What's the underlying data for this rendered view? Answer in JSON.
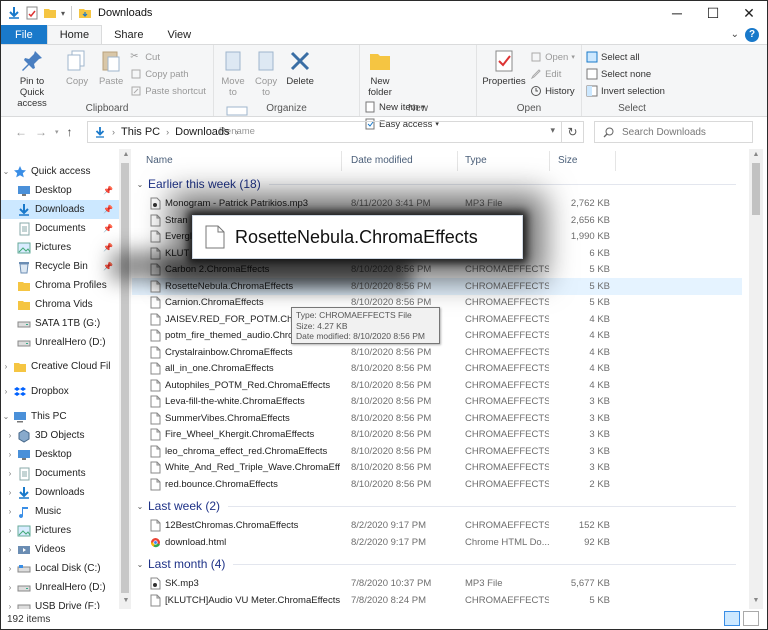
{
  "window": {
    "title": "Downloads",
    "controls": [
      "─",
      "☐",
      "✕"
    ]
  },
  "tabs": [
    {
      "label": "File"
    },
    {
      "label": "Home"
    },
    {
      "label": "Share"
    },
    {
      "label": "View"
    }
  ],
  "ribbon": {
    "clipboard": {
      "label": "Clipboard",
      "pin": "Pin to Quick access",
      "copy": "Copy",
      "paste": "Paste",
      "cut": "Cut",
      "copy_path": "Copy path",
      "paste_shortcut": "Paste shortcut"
    },
    "organize": {
      "label": "Organize",
      "move_to": "Move to",
      "copy_to": "Copy to",
      "delete": "Delete",
      "rename": "Rename"
    },
    "new": {
      "label": "New",
      "new_folder": "New folder",
      "new_item": "New item",
      "easy_access": "Easy access"
    },
    "open": {
      "label": "Open",
      "properties": "Properties",
      "open": "Open",
      "edit": "Edit",
      "history": "History"
    },
    "select": {
      "label": "Select",
      "select_all": "Select all",
      "select_none": "Select none",
      "invert": "Invert selection"
    }
  },
  "address": {
    "path": [
      "This PC",
      "Downloads"
    ],
    "search_placeholder": "Search Downloads"
  },
  "nav": {
    "items": [
      {
        "label": "Quick access"
      },
      {
        "label": "Desktop"
      },
      {
        "label": "Downloads"
      },
      {
        "label": "Documents"
      },
      {
        "label": "Pictures"
      },
      {
        "label": "Recycle Bin"
      },
      {
        "label": "Chroma Profiles"
      },
      {
        "label": "Chroma Vids"
      },
      {
        "label": "SATA 1TB (G:)"
      },
      {
        "label": "UnrealHero (D:)"
      },
      {
        "label": "Creative Cloud Fil"
      },
      {
        "label": "Dropbox"
      },
      {
        "label": "This PC"
      },
      {
        "label": "3D Objects"
      },
      {
        "label": "Desktop"
      },
      {
        "label": "Documents"
      },
      {
        "label": "Downloads"
      },
      {
        "label": "Music"
      },
      {
        "label": "Pictures"
      },
      {
        "label": "Videos"
      },
      {
        "label": "Local Disk (C:)"
      },
      {
        "label": "UnrealHero (D:)"
      },
      {
        "label": "USB Drive (F:)"
      }
    ]
  },
  "columns": {
    "name": "Name",
    "date": "Date modified",
    "type": "Type",
    "size": "Size"
  },
  "groups": [
    {
      "label": "Earlier this week (18)"
    },
    {
      "label": "Last week (2)"
    },
    {
      "label": "Last month (4)"
    }
  ],
  "files": [
    {
      "name": "Monogram - Patrick Patrikios.mp3",
      "date": "8/11/2020 3:41 PM",
      "type": "MP3 File",
      "size": "2,762 KB"
    },
    {
      "name": "Stran",
      "date": "",
      "type": "",
      "size": "2,656 KB"
    },
    {
      "name": "Evergl",
      "date": "",
      "type": "",
      "size": "1,990 KB"
    },
    {
      "name": "KLUT",
      "date": "",
      "type": "",
      "size": "6 KB"
    },
    {
      "name": "Carbon 2.ChromaEffects",
      "date": "8/10/2020 8:56 PM",
      "type": "CHROMAEFFECTS...",
      "size": "5 KB"
    },
    {
      "name": "RosetteNebula.ChromaEffects",
      "date": "8/10/2020 8:56 PM",
      "type": "CHROMAEFFECTS...",
      "size": "5 KB"
    },
    {
      "name": "Carnion.ChromaEffects",
      "date": "8/10/2020 8:56 PM",
      "type": "CHROMAEFFECTS...",
      "size": "5 KB"
    },
    {
      "name": "JAISEV.RED_FOR_POTM.Chrom",
      "date": "8/10/2020 8:56 PM",
      "type": "CHROMAEFFECTS...",
      "size": "4 KB"
    },
    {
      "name": "potm_fire_themed_audio.Chrom",
      "date": "8/10/2020 8:56 PM",
      "type": "CHROMAEFFECTS...",
      "size": "4 KB"
    },
    {
      "name": "Crystalrainbow.ChromaEffects",
      "date": "8/10/2020 8:56 PM",
      "type": "CHROMAEFFECTS...",
      "size": "4 KB"
    },
    {
      "name": "all_in_one.ChromaEffects",
      "date": "8/10/2020 8:56 PM",
      "type": "CHROMAEFFECTS...",
      "size": "4 KB"
    },
    {
      "name": "Autophiles_POTM_Red.ChromaEffects",
      "date": "8/10/2020 8:56 PM",
      "type": "CHROMAEFFECTS...",
      "size": "4 KB"
    },
    {
      "name": "Leva-fill-the-white.ChromaEffects",
      "date": "8/10/2020 8:56 PM",
      "type": "CHROMAEFFECTS...",
      "size": "3 KB"
    },
    {
      "name": "SummerVibes.ChromaEffects",
      "date": "8/10/2020 8:56 PM",
      "type": "CHROMAEFFECTS...",
      "size": "3 KB"
    },
    {
      "name": "Fire_Wheel_Khergit.ChromaEffects",
      "date": "8/10/2020 8:56 PM",
      "type": "CHROMAEFFECTS...",
      "size": "3 KB"
    },
    {
      "name": "leo_chroma_effect_red.ChromaEffects",
      "date": "8/10/2020 8:56 PM",
      "type": "CHROMAEFFECTS...",
      "size": "3 KB"
    },
    {
      "name": "White_And_Red_Triple_Wave.ChromaEffe...",
      "date": "8/10/2020 8:56 PM",
      "type": "CHROMAEFFECTS...",
      "size": "3 KB"
    },
    {
      "name": "red.bounce.ChromaEffects",
      "date": "8/10/2020 8:56 PM",
      "type": "CHROMAEFFECTS...",
      "size": "2 KB"
    },
    {
      "name": "12BestChromas.ChromaEffects",
      "date": "8/2/2020 9:17 PM",
      "type": "CHROMAEFFECTS...",
      "size": "152 KB"
    },
    {
      "name": "download.html",
      "date": "8/2/2020 9:17 PM",
      "type": "Chrome HTML Do...",
      "size": "92 KB"
    },
    {
      "name": "SK.mp3",
      "date": "7/8/2020 10:37 PM",
      "type": "MP3 File",
      "size": "5,677 KB"
    },
    {
      "name": "[KLUTCH]Audio VU Meter.ChromaEffects",
      "date": "7/8/2020 8:24 PM",
      "type": "CHROMAEFFECTS...",
      "size": "5 KB"
    }
  ],
  "drag": {
    "name": "RosetteNebula.ChromaEffects"
  },
  "tooltip": {
    "type": "Type: CHROMAEFFECTS File",
    "size": "Size: 4.27 KB",
    "date": "Date modified: 8/10/2020 8:56 PM"
  },
  "status": {
    "count": "192 items"
  }
}
